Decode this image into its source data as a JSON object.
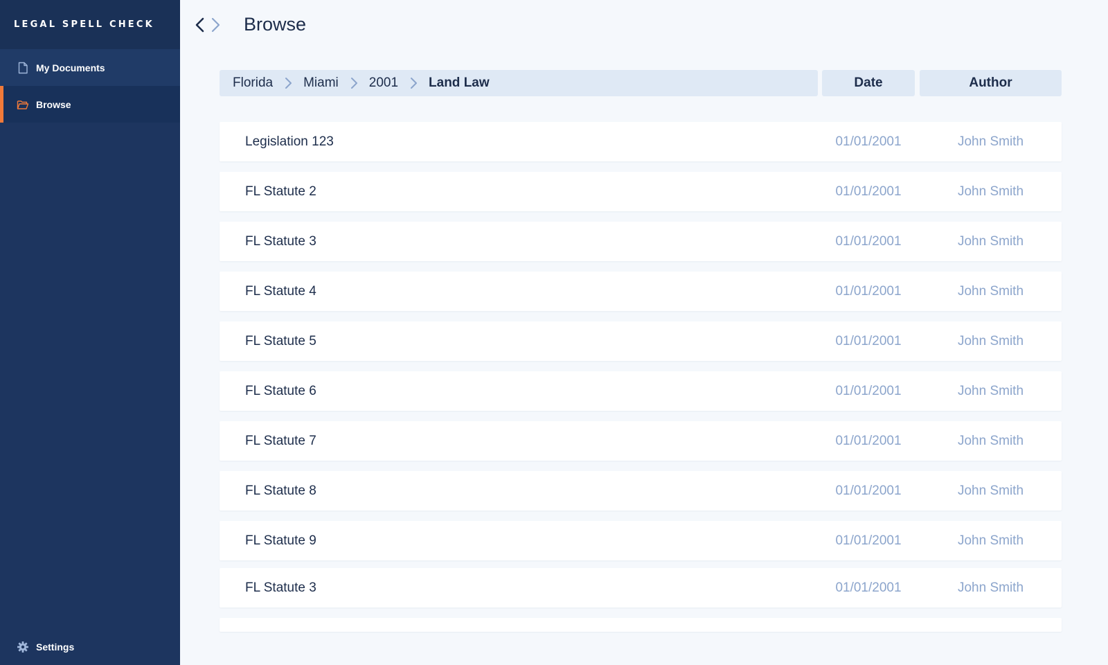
{
  "app": {
    "brand": "LEGAL SPELL CHECK"
  },
  "sidebar": {
    "items": [
      {
        "label": "My Documents",
        "icon": "document-icon"
      },
      {
        "label": "Browse",
        "icon": "folder-open-icon",
        "active": true
      }
    ],
    "settings_label": "Settings"
  },
  "header": {
    "title": "Browse"
  },
  "breadcrumb": [
    "Florida",
    "Miami",
    "2001",
    "Land Law"
  ],
  "columns": {
    "date": "Date",
    "author": "Author"
  },
  "rows": [
    {
      "name": "Legislation 123",
      "date": "01/01/2001",
      "author": "John Smith"
    },
    {
      "name": "FL Statute 2",
      "date": "01/01/2001",
      "author": "John Smith"
    },
    {
      "name": "FL Statute 3",
      "date": "01/01/2001",
      "author": "John Smith"
    },
    {
      "name": "FL Statute 4",
      "date": "01/01/2001",
      "author": "John Smith"
    },
    {
      "name": "FL Statute 5",
      "date": "01/01/2001",
      "author": "John Smith"
    },
    {
      "name": "FL Statute 6",
      "date": "01/01/2001",
      "author": "John Smith"
    },
    {
      "name": "FL Statute 7",
      "date": "01/01/2001",
      "author": "John Smith"
    },
    {
      "name": "FL Statute 8",
      "date": "01/01/2001",
      "author": "John Smith"
    },
    {
      "name": "FL Statute 9",
      "date": "01/01/2001",
      "author": "John Smith"
    },
    {
      "name": "FL Statute 3",
      "date": "01/01/2001",
      "author": "John Smith"
    }
  ],
  "colors": {
    "sidebar_bg": "#1d355f",
    "accent": "#f07a3a",
    "text_dark": "#1d2d4b",
    "text_muted": "#8ca5cc",
    "header_bg": "#dfe9f5"
  }
}
